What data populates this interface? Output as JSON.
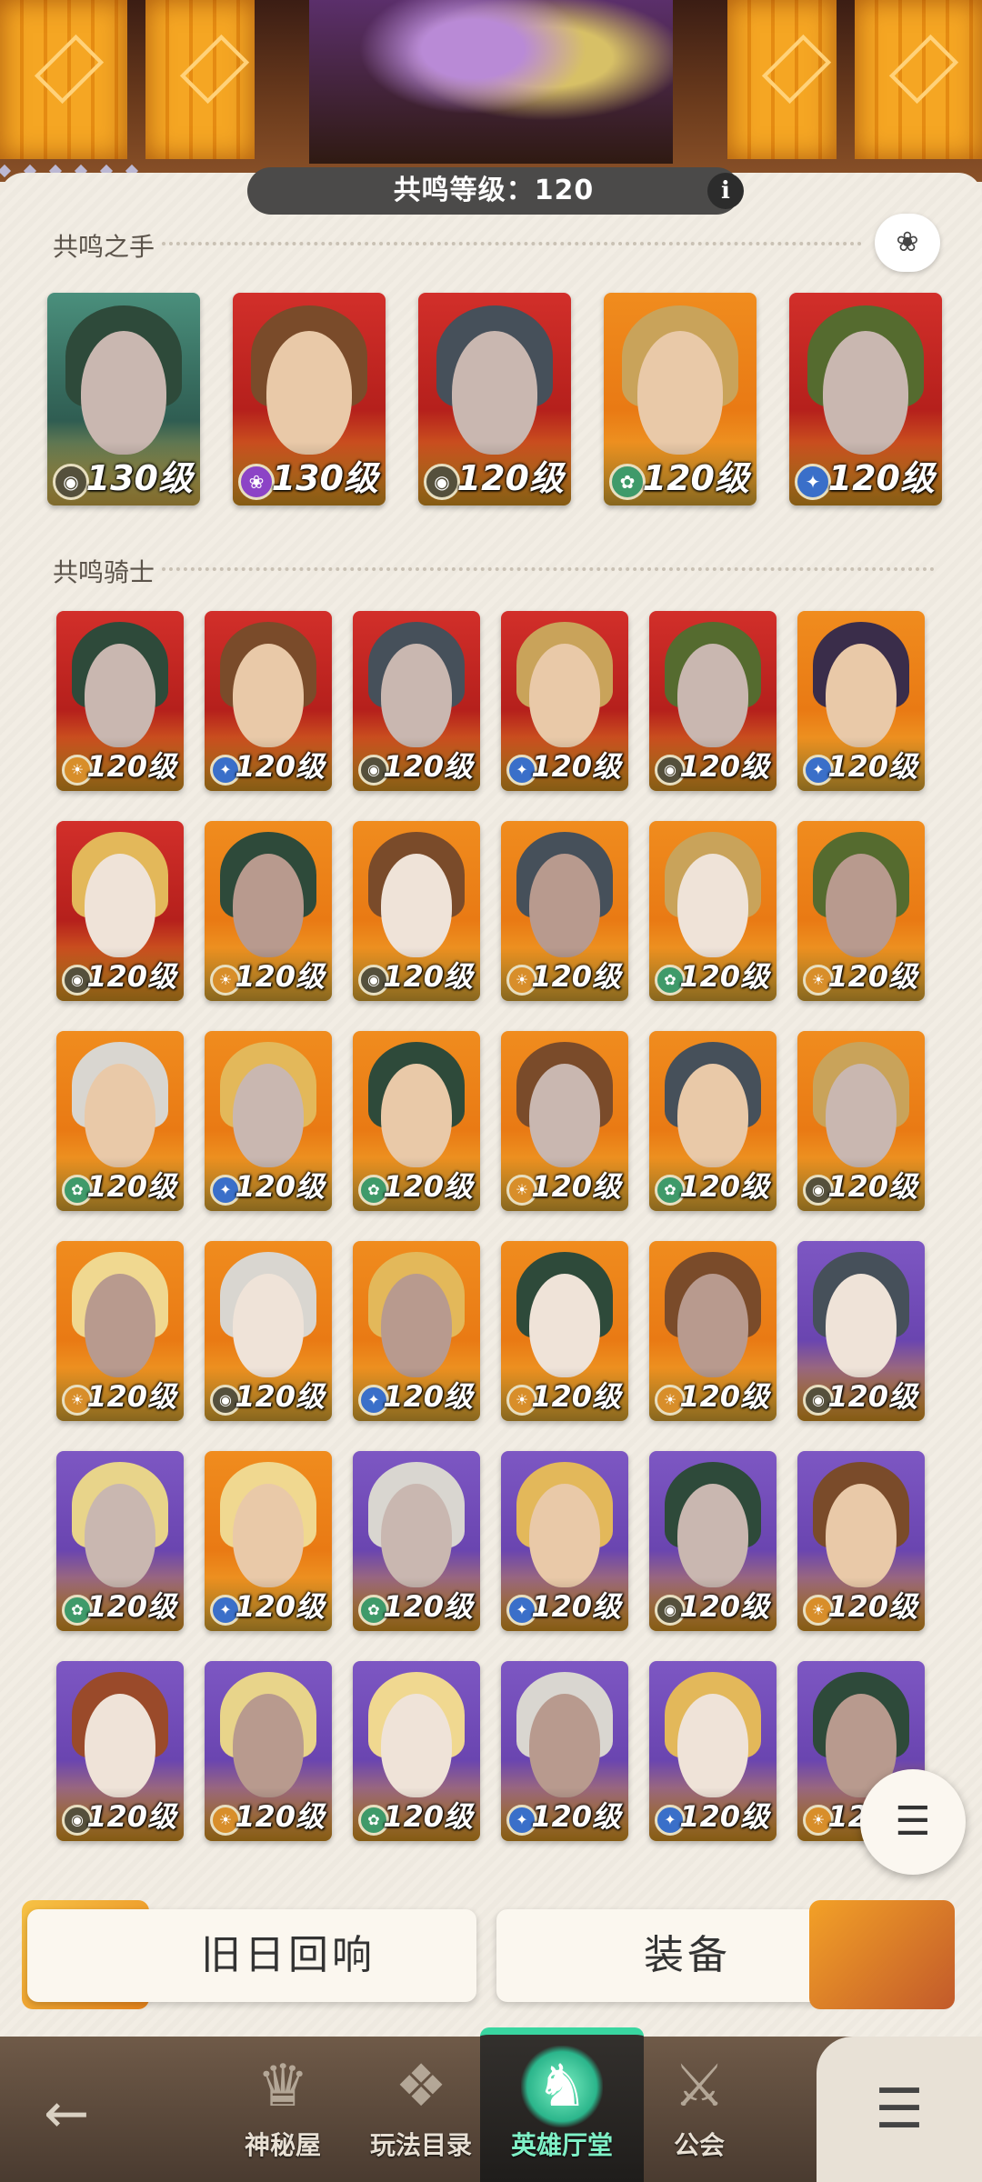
{
  "header": {
    "resonance_level_label": "共鸣等级：",
    "resonance_level_value": "120",
    "info_label": "i"
  },
  "sections": {
    "hands_title": "共鸣之手",
    "knights_title": "共鸣骑士"
  },
  "hands": [
    {
      "level": "130级",
      "faction": "dark",
      "bg": "teal"
    },
    {
      "level": "130级",
      "faction": "purple",
      "bg": "red"
    },
    {
      "level": "120级",
      "faction": "dark",
      "bg": "red"
    },
    {
      "level": "120级",
      "faction": "green",
      "bg": "orange"
    },
    {
      "level": "120级",
      "faction": "blue",
      "bg": "red"
    }
  ],
  "knights": [
    {
      "level": "120级",
      "faction": "gold",
      "bg": "red"
    },
    {
      "level": "120级",
      "faction": "blue",
      "bg": "red"
    },
    {
      "level": "120级",
      "faction": "dark",
      "bg": "red"
    },
    {
      "level": "120级",
      "faction": "blue",
      "bg": "red"
    },
    {
      "level": "120级",
      "faction": "dark",
      "bg": "red"
    },
    {
      "level": "120级",
      "faction": "blue",
      "bg": "orange"
    },
    {
      "level": "120级",
      "faction": "dark",
      "bg": "red"
    },
    {
      "level": "120级",
      "faction": "gold",
      "bg": "orange"
    },
    {
      "level": "120级",
      "faction": "dark",
      "bg": "orange"
    },
    {
      "level": "120级",
      "faction": "gold",
      "bg": "orange"
    },
    {
      "level": "120级",
      "faction": "green",
      "bg": "orange"
    },
    {
      "level": "120级",
      "faction": "gold",
      "bg": "orange"
    },
    {
      "level": "120级",
      "faction": "green",
      "bg": "orange"
    },
    {
      "level": "120级",
      "faction": "blue",
      "bg": "orange"
    },
    {
      "level": "120级",
      "faction": "green",
      "bg": "orange"
    },
    {
      "level": "120级",
      "faction": "gold",
      "bg": "orange"
    },
    {
      "level": "120级",
      "faction": "green",
      "bg": "orange"
    },
    {
      "level": "120级",
      "faction": "dark",
      "bg": "orange"
    },
    {
      "level": "120级",
      "faction": "gold",
      "bg": "orange"
    },
    {
      "level": "120级",
      "faction": "dark",
      "bg": "orange"
    },
    {
      "level": "120级",
      "faction": "blue",
      "bg": "orange"
    },
    {
      "level": "120级",
      "faction": "gold",
      "bg": "orange"
    },
    {
      "level": "120级",
      "faction": "gold",
      "bg": "orange"
    },
    {
      "level": "120级",
      "faction": "dark",
      "bg": "purple"
    },
    {
      "level": "120级",
      "faction": "green",
      "bg": "purple"
    },
    {
      "level": "120级",
      "faction": "blue",
      "bg": "orange"
    },
    {
      "level": "120级",
      "faction": "green",
      "bg": "purple"
    },
    {
      "level": "120级",
      "faction": "blue",
      "bg": "purple"
    },
    {
      "level": "120级",
      "faction": "dark",
      "bg": "purple"
    },
    {
      "level": "120级",
      "faction": "gold",
      "bg": "purple"
    },
    {
      "level": "120级",
      "faction": "dark",
      "bg": "purple"
    },
    {
      "level": "120级",
      "faction": "gold",
      "bg": "purple"
    },
    {
      "level": "120级",
      "faction": "green",
      "bg": "purple"
    },
    {
      "level": "120级",
      "faction": "blue",
      "bg": "purple"
    },
    {
      "level": "120级",
      "faction": "blue",
      "bg": "purple"
    },
    {
      "level": "120级",
      "faction": "gold",
      "bg": "purple"
    }
  ],
  "bottom_buttons": {
    "echo_label": "旧日回响",
    "equipment_label": "装备"
  },
  "nav": {
    "items": [
      {
        "label": "神秘屋",
        "icon": "mystic-house-icon",
        "active": false
      },
      {
        "label": "玩法目录",
        "icon": "game-modes-icon",
        "active": false
      },
      {
        "label": "英雄厅堂",
        "icon": "hero-hall-icon",
        "active": true
      },
      {
        "label": "公会",
        "icon": "guild-icon",
        "active": false
      }
    ]
  },
  "colors": {
    "accent_active": "#39d6a0",
    "pill_bg": "#4b4a49",
    "panel_bg": "#f2ede4"
  }
}
